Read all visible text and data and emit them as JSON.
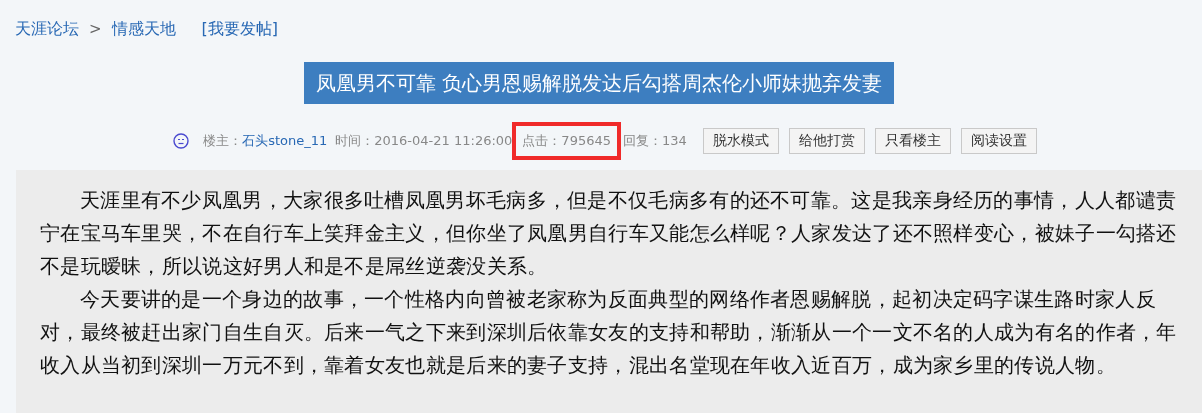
{
  "breadcrumb": {
    "items": [
      {
        "label": "天涯论坛"
      },
      {
        "label": "情感天地"
      }
    ],
    "separator": ">",
    "post_link": "[我要发帖]"
  },
  "post": {
    "title": "凤凰男不可靠 负心男恩赐解脱发达后勾搭周杰伦小师妹抛弃发妻",
    "meta": {
      "author_label": "楼主：",
      "author": "石头stone_11",
      "time_label": "时间：",
      "time": "2016-04-21 11:26:00",
      "hits_label": "点击：",
      "hits": "795645",
      "hits_highlighted": true,
      "replies_label": "回复：",
      "replies": "134"
    },
    "actions": [
      "脱水模式",
      "给他打赏",
      "只看楼主",
      "阅读设置"
    ],
    "paragraphs": [
      "天涯里有不少凤凰男，大家很多吐槽凤凰男坏毛病多，但是不仅毛病多有的还不可靠。这是我亲身经历的事情，人人都谴责宁在宝马车里哭，不在自行车上笑拜金主义，但你坐了凤凰男自行车又能怎么样呢？人家发达了还不照样变心，被妹子一勾搭还不是玩暧昧，所以说这好男人和是不是屌丝逆袭没关系。",
      "今天要讲的是一个身边的故事，一个性格内向曾被老家称为反面典型的网络作者恩赐解脱，起初决定码字谋生路时家人反对，最终被赶出家门自生自灭。后来一气之下来到深圳后依靠女友的支持和帮助，渐渐从一个一文不名的人成为有名的作者，年收入从当初到深圳一万元不到，靠着女友也就是后来的妻子支持，混出名堂现在年收入近百万，成为家乡里的传说人物。"
    ]
  }
}
